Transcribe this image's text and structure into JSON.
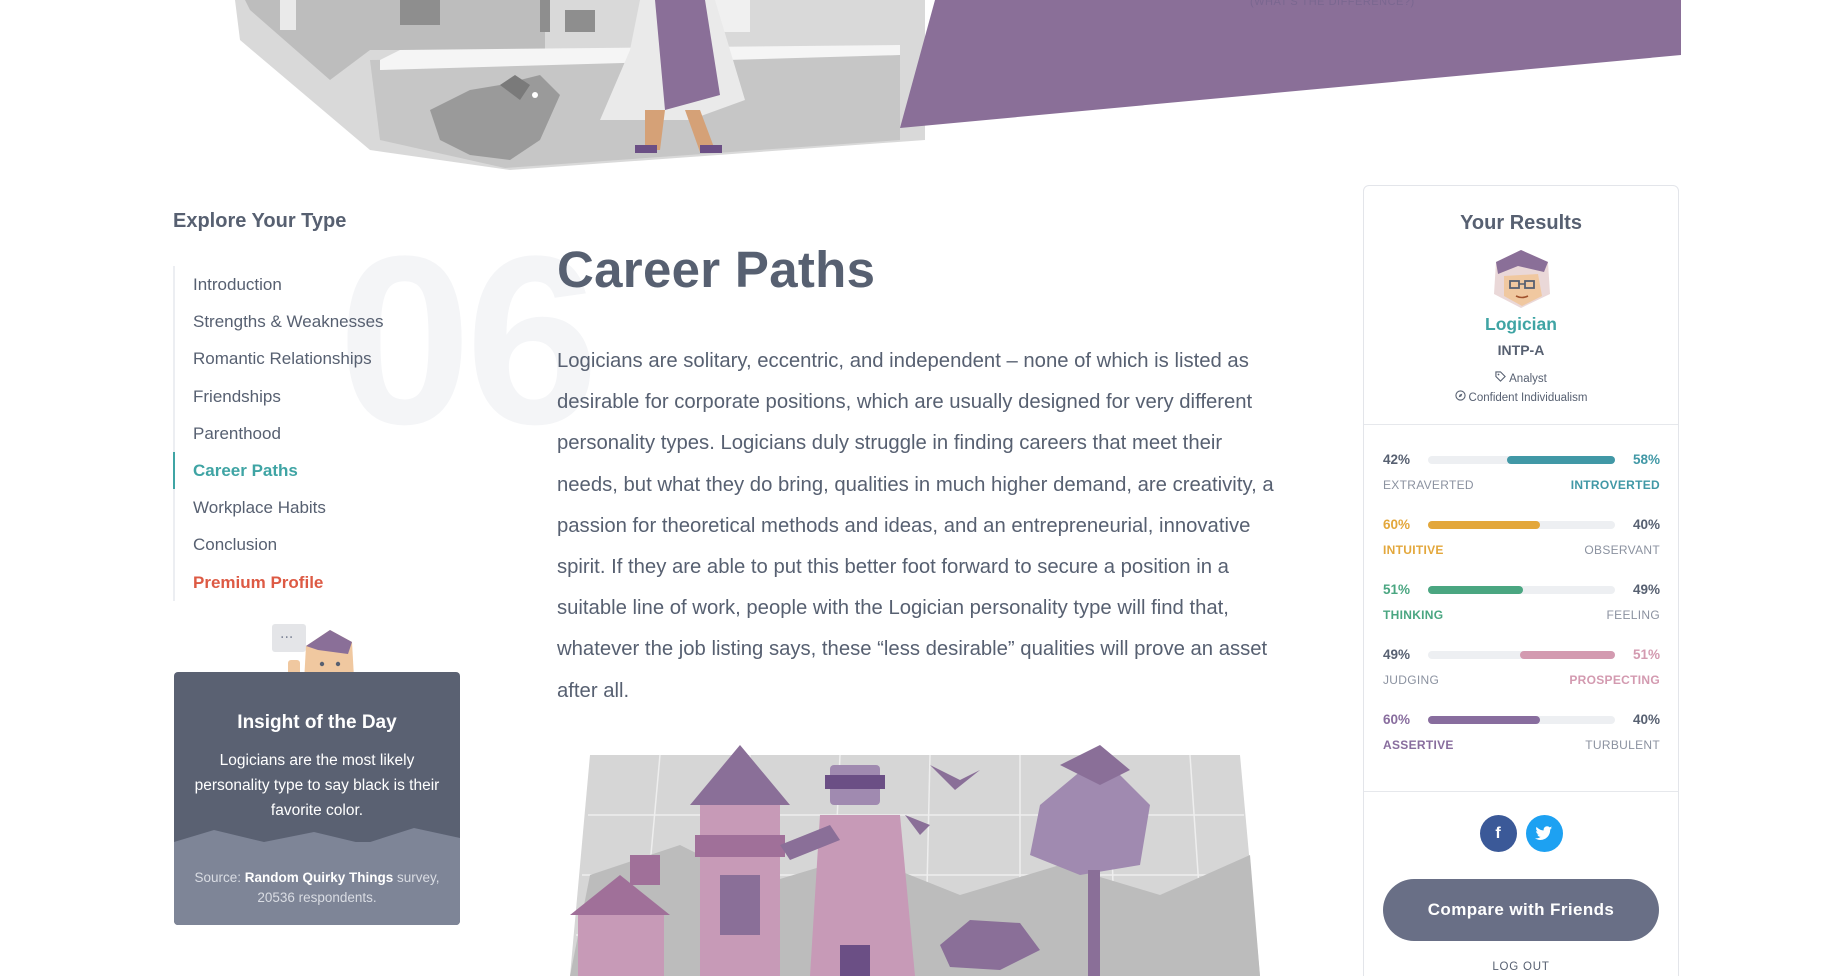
{
  "hero": {
    "caption": "(WHAT'S THE DIFFERENCE?)"
  },
  "sidebar": {
    "title": "Explore Your Type",
    "section_number": "06",
    "items": [
      {
        "label": "Introduction"
      },
      {
        "label": "Strengths & Weaknesses"
      },
      {
        "label": "Romantic Relationships"
      },
      {
        "label": "Friendships"
      },
      {
        "label": "Parenthood"
      },
      {
        "label": "Career Paths",
        "active": true
      },
      {
        "label": "Workplace Habits"
      },
      {
        "label": "Conclusion"
      },
      {
        "label": "Premium Profile",
        "premium": true
      }
    ]
  },
  "insight": {
    "title": "Insight of the Day",
    "text": "Logicians are the most likely personality type to say black is their favorite color.",
    "source_prefix": "Source: ",
    "source_name": "Random Quirky Things",
    "source_suffix": " survey, 20536 respondents."
  },
  "main": {
    "title": "Career Paths",
    "body": "Logicians are solitary, eccentric, and independent – none of which is listed as desirable for corporate positions, which are usually designed for very different personality types. Logicians duly struggle in finding careers that meet their needs, but what they do bring, qualities in much higher demand, are creativity, a passion for theoretical methods and ideas, and an entrepreneurial, innovative spirit. If they are able to put this better foot forward to secure a position in a suitable line of work, people with the Logician personality type will find that, whatever the job listing says, these “less desirable” qualities will prove an asset after all."
  },
  "results": {
    "title": "Your Results",
    "type_name": "Logician",
    "type_code": "INTP-A",
    "role": "Analyst",
    "strategy": "Confident Individualism",
    "traits": [
      {
        "left_pct": "42%",
        "right_pct": "58%",
        "left_label": "EXTRAVERTED",
        "right_label": "INTROVERTED",
        "dominant": "right",
        "value": 58,
        "color": "#4198a6"
      },
      {
        "left_pct": "60%",
        "right_pct": "40%",
        "left_label": "INTUITIVE",
        "right_label": "OBSERVANT",
        "dominant": "left",
        "value": 60,
        "color": "#e3a73b"
      },
      {
        "left_pct": "51%",
        "right_pct": "49%",
        "left_label": "THINKING",
        "right_label": "FEELING",
        "dominant": "left",
        "value": 51,
        "color": "#4aa681"
      },
      {
        "left_pct": "49%",
        "right_pct": "51%",
        "left_label": "JUDGING",
        "right_label": "PROSPECTING",
        "dominant": "right",
        "value": 51,
        "color": "#d39ab0"
      },
      {
        "left_pct": "60%",
        "right_pct": "40%",
        "left_label": "ASSERTIVE",
        "right_label": "TURBULENT",
        "dominant": "left",
        "value": 60,
        "color": "#886d9e"
      }
    ],
    "social": [
      {
        "name": "facebook",
        "glyph": "f",
        "color": "#3b5998"
      },
      {
        "name": "twitter",
        "glyph": "t",
        "color": "#1da1f2"
      }
    ],
    "compare_label": "Compare with Friends",
    "logout_label": "LOG OUT"
  },
  "colors": {
    "accent": "#3fa4a4",
    "premium": "#dd5a44",
    "purple": "#8a6f98",
    "dark_card": "#5a6172"
  },
  "icons": [
    "tag-icon",
    "compass-icon",
    "facebook-icon",
    "twitter-icon"
  ]
}
